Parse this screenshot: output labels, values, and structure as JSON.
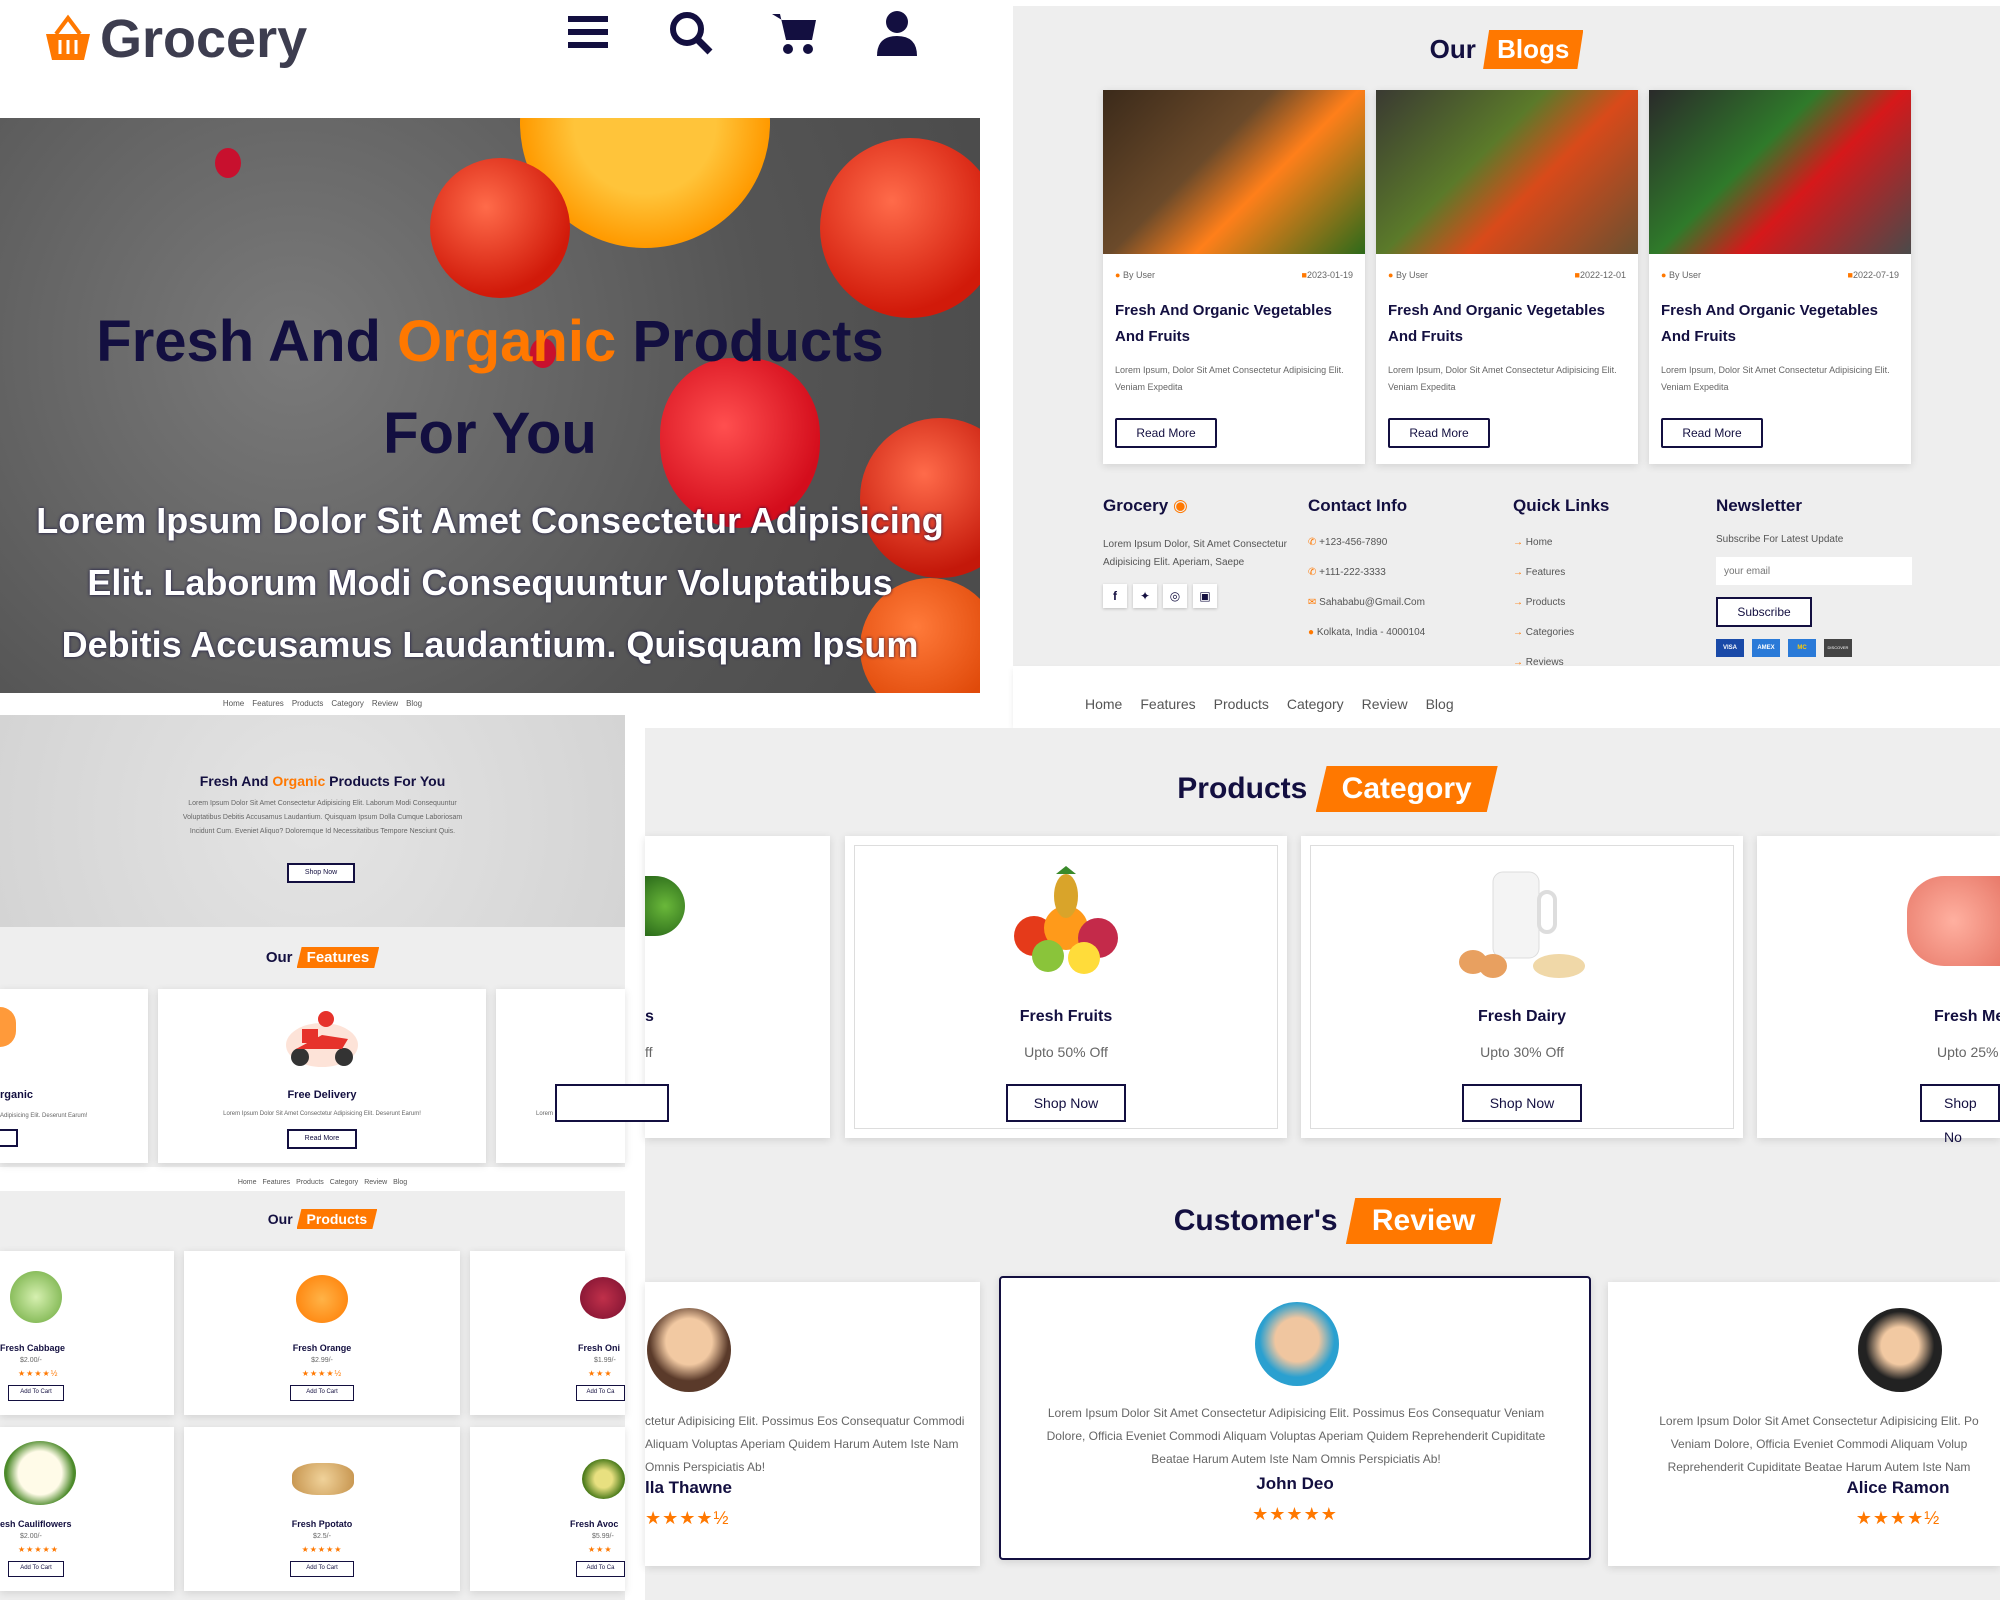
{
  "header": {
    "logo_text": "Grocery",
    "icons": [
      "menu-icon",
      "search-icon",
      "cart-icon",
      "user-icon"
    ]
  },
  "hero": {
    "title_1": "Fresh And ",
    "title_accent": "Organic",
    "title_2": " Products",
    "title_3": "For You",
    "body_1": "Lorem Ipsum Dolor Sit Amet Consectetur Adipisicing",
    "body_2": "Elit. Laborum Modi Consequuntur Voluptatibus",
    "body_3": "Debitis Accusamus Laudantium. Quisquam Ipsum"
  },
  "blogs": {
    "heading_1": "Our",
    "heading_2": "Blogs",
    "items": [
      {
        "user": "By User",
        "date": "2023-01-19",
        "title": "Fresh And Organic Vegetables And Fruits",
        "desc": "Lorem Ipsum, Dolor Sit Amet Consectetur Adipisicing Elit. Veniam Expedita",
        "button": "Read More"
      },
      {
        "user": "By User",
        "date": "2022-12-01",
        "title": "Fresh And Organic Vegetables And Fruits",
        "desc": "Lorem Ipsum, Dolor Sit Amet Consectetur Adipisicing Elit. Veniam Expedita",
        "button": "Read More"
      },
      {
        "user": "By User",
        "date": "2022-07-19",
        "title": "Fresh And Organic Vegetables And Fruits",
        "desc": "Lorem Ipsum, Dolor Sit Amet Consectetur Adipisicing Elit. Veniam Expedita",
        "button": "Read More"
      }
    ]
  },
  "footer": {
    "brand": "Grocery",
    "brand_desc": "Lorem Ipsum Dolor, Sit Amet Consectetur Adipisicing Elit. Aperiam, Saepe",
    "contact_title": "Contact Info",
    "contact": [
      "+123-456-7890",
      "+111-222-3333",
      "Sahababu@Gmail.Com",
      "Kolkata, India - 4000104"
    ],
    "links_title": "Quick Links",
    "links": [
      "Home",
      "Features",
      "Products",
      "Categories",
      "Reviews"
    ],
    "newsletter_title": "Newsletter",
    "newsletter_sub": "Subscribe For Latest Update",
    "email_placeholder": "your email",
    "subscribe": "Subscribe",
    "cards": [
      "VISA",
      "AMEX",
      "MC",
      "DISCOVER"
    ]
  },
  "nav": [
    "Home",
    "Features",
    "Products",
    "Category",
    "Review",
    "Blog"
  ],
  "small_hero": {
    "title_1": "Fresh And ",
    "title_accent": "Organic",
    "title_2": " Products For You",
    "body": "Lorem Ipsum Dolor Sit Amet Consectetur Adipisicing Elit. Laborum Modi Consequuntur Voluptatibus Debitis Accusamus Laudantium. Quisquam Ipsum Dolla Cumque Laboriosam Incidunt Cum. Eveniet Aliquo? Doloremque Id Necessitatibus Tempore Nesciunt Quis.",
    "button": "Shop Now"
  },
  "features": {
    "heading_1": "Our",
    "heading_2": "Features",
    "left_title": "rganic",
    "left_desc": "Adipisicing Elit. Deserunt Earum!",
    "center_title": "Free Delivery",
    "center_desc": "Lorem Ipsum Dolor Sit Amet Consectetur Adipisicing Elit. Deserunt Earum!",
    "center_button": "Read More",
    "right_title": "E",
    "right_desc": "Lorem Ipsum Dolor Sit Am"
  },
  "products": {
    "heading_1": "Our",
    "heading_2": "Products",
    "items": [
      {
        "name": "Fresh Cabbage",
        "price": "$2.00/-",
        "stars": "★★★★½",
        "button": "Add To Cart"
      },
      {
        "name": "Fresh Orange",
        "price": "$2.99/-",
        "stars": "★★★★½",
        "button": "Add To Cart"
      },
      {
        "name": "Fresh Oni",
        "price": "$1.99/-",
        "stars": "★★★",
        "button": "Add To Ca"
      },
      {
        "name": "esh Cauliflowers",
        "price": "$2.00/-",
        "stars": "★★★★★",
        "button": "Add To Cart"
      },
      {
        "name": "Fresh Ppotato",
        "price": "$2.5/-",
        "stars": "★★★★★",
        "button": "Add To Cart"
      },
      {
        "name": "Fresh Avoc",
        "price": "$5.99/-",
        "stars": "★★★",
        "button": "Add To Ca"
      }
    ]
  },
  "category": {
    "heading_1": "Products",
    "heading_2": "Category",
    "left_title": "s",
    "left_off": "ff",
    "items": [
      {
        "name": "Fresh Fruits",
        "off": "Upto 50% Off",
        "button": "Shop Now"
      },
      {
        "name": "Fresh Dairy",
        "off": "Upto 30% Off",
        "button": "Shop Now"
      },
      {
        "name": "Fresh Me",
        "off": "Upto 25%",
        "button": "Shop No"
      }
    ]
  },
  "reviews": {
    "heading_1": "Customer's",
    "heading_2": "Review",
    "items": [
      {
        "text": "ctetur Adipisicing Elit. Possimus Eos Consequatur Commodi Aliquam Voluptas Aperiam Quidem Harum Autem Iste Nam Omnis Perspiciatis Ab!",
        "name": "lla Thawne",
        "stars": "★★★★½"
      },
      {
        "text": "Lorem Ipsum Dolor Sit Amet Consectetur Adipisicing Elit. Possimus Eos Consequatur Veniam Dolore, Officia Eveniet Commodi Aliquam Voluptas Aperiam Quidem Reprehenderit Cupiditate Beatae Harum Autem Iste Nam Omnis Perspiciatis Ab!",
        "name": "John Deo",
        "stars": "★★★★★"
      },
      {
        "text": "Lorem Ipsum Dolor Sit Amet Consectetur Adipisicing Elit. Po Veniam Dolore, Officia Eveniet Commodi Aliquam Volup Reprehenderit Cupiditate Beatae Harum Autem Iste Nam",
        "name": "Alice Ramon",
        "stars": "★★★★½"
      }
    ]
  },
  "colors": {
    "accent": "#ff7800",
    "dark": "#130f40",
    "panel": "#eeeeee"
  }
}
